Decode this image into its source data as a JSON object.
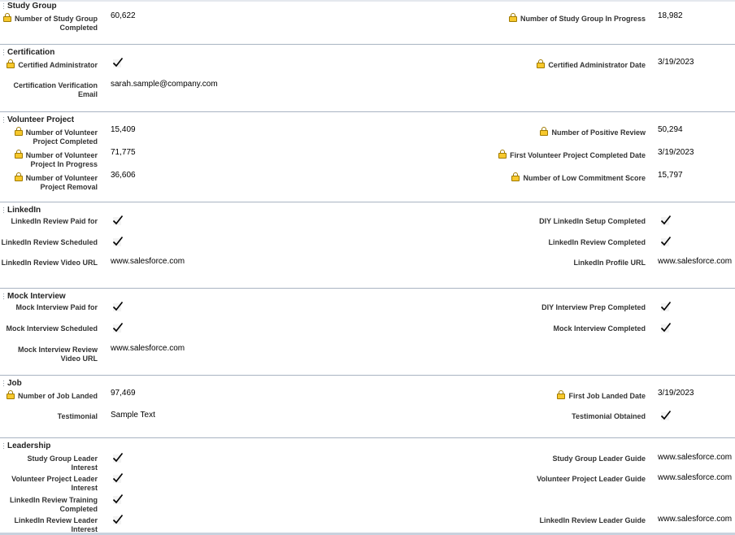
{
  "sections": [
    {
      "title": "Study Group",
      "rows": [
        {
          "left": {
            "label": "Number of Study Group Completed",
            "lock": true,
            "value": "60,622"
          },
          "right": {
            "label": "Number of Study Group In Progress",
            "lock": true,
            "value": "18,982"
          }
        }
      ]
    },
    {
      "title": "Certification",
      "rows": [
        {
          "left": {
            "label": "Certified Administrator",
            "lock": true,
            "checked": true
          },
          "right": {
            "label": "Certified Administrator Date",
            "lock": true,
            "value": "3/19/2023"
          }
        },
        {
          "left": {
            "label": "Certification Verification Email",
            "lock": false,
            "value": "sarah.sample@company.com"
          }
        }
      ]
    },
    {
      "title": "Volunteer Project",
      "rows": [
        {
          "left": {
            "label": "Number of Volunteer Project Completed",
            "lock": true,
            "value": "15,409"
          },
          "right": {
            "label": "Number of Positive Review",
            "lock": true,
            "value": "50,294"
          }
        },
        {
          "left": {
            "label": "Number of Volunteer Project In Progress",
            "lock": true,
            "value": "71,775"
          },
          "right": {
            "label": "First Volunteer Project Completed Date",
            "lock": true,
            "value": "3/19/2023"
          }
        },
        {
          "left": {
            "label": "Number of Volunteer Project Removal",
            "lock": true,
            "value": "36,606"
          },
          "right": {
            "label": "Number of Low Commitment Score",
            "lock": true,
            "value": "15,797"
          }
        }
      ]
    },
    {
      "title": "LinkedIn",
      "rows": [
        {
          "left": {
            "label": "LinkedIn Review Paid for",
            "lock": false,
            "checked": true
          },
          "right": {
            "label": "DIY LinkedIn Setup Completed",
            "lock": false,
            "checked": true
          }
        },
        {
          "left": {
            "label": "LinkedIn Review Scheduled",
            "lock": false,
            "checked": true
          },
          "right": {
            "label": "LinkedIn Review Completed",
            "lock": false,
            "checked": true
          }
        },
        {
          "left": {
            "label": "LinkedIn Review Video URL",
            "lock": false,
            "value": "www.salesforce.com"
          },
          "right": {
            "label": "LinkedIn Profile URL",
            "lock": false,
            "value": "www.salesforce.com"
          }
        }
      ]
    },
    {
      "title": "Mock Interview",
      "rows": [
        {
          "left": {
            "label": "Mock Interview Paid for",
            "lock": false,
            "checked": true
          },
          "right": {
            "label": "DIY Interview Prep Completed",
            "lock": false,
            "checked": true
          }
        },
        {
          "left": {
            "label": "Mock Interview Scheduled",
            "lock": false,
            "checked": true
          },
          "right": {
            "label": "Mock Interview Completed",
            "lock": false,
            "checked": true
          }
        },
        {
          "left": {
            "label": "Mock Interview Review Video URL",
            "lock": false,
            "value": "www.salesforce.com"
          }
        }
      ]
    },
    {
      "title": "Job",
      "rows": [
        {
          "left": {
            "label": "Number of Job Landed",
            "lock": true,
            "value": "97,469"
          },
          "right": {
            "label": "First Job Landed Date",
            "lock": true,
            "value": "3/19/2023"
          }
        },
        {
          "left": {
            "label": "Testimonial",
            "lock": false,
            "value": "Sample Text"
          },
          "right": {
            "label": "Testimonial Obtained",
            "lock": false,
            "checked": true
          }
        }
      ]
    },
    {
      "title": "Leadership",
      "rows": [
        {
          "left": {
            "label": "Study Group Leader Interest",
            "lock": false,
            "checked": true
          },
          "right": {
            "label": "Study Group Leader Guide",
            "lock": false,
            "value": "www.salesforce.com"
          }
        },
        {
          "left": {
            "label": "Volunteer Project Leader Interest",
            "lock": false,
            "checked": true
          },
          "right": {
            "label": "Volunteer Project Leader Guide",
            "lock": false,
            "value": "www.salesforce.com"
          }
        },
        {
          "left": {
            "label": "LinkedIn Review Training Completed",
            "lock": false,
            "checked": true
          }
        },
        {
          "left": {
            "label": "LinkedIn Review Leader Interest",
            "lock": false,
            "checked": true
          },
          "right": {
            "label": "LinkedIn Review Leader Guide",
            "lock": false,
            "value": "www.salesforce.com"
          }
        }
      ]
    }
  ],
  "icons": {
    "lock": "lock-icon",
    "check": "checkmark-icon",
    "grip": "drag-handle-icon"
  },
  "colors": {
    "lock": "#f7c82c",
    "separator": "#a9b4c2"
  }
}
